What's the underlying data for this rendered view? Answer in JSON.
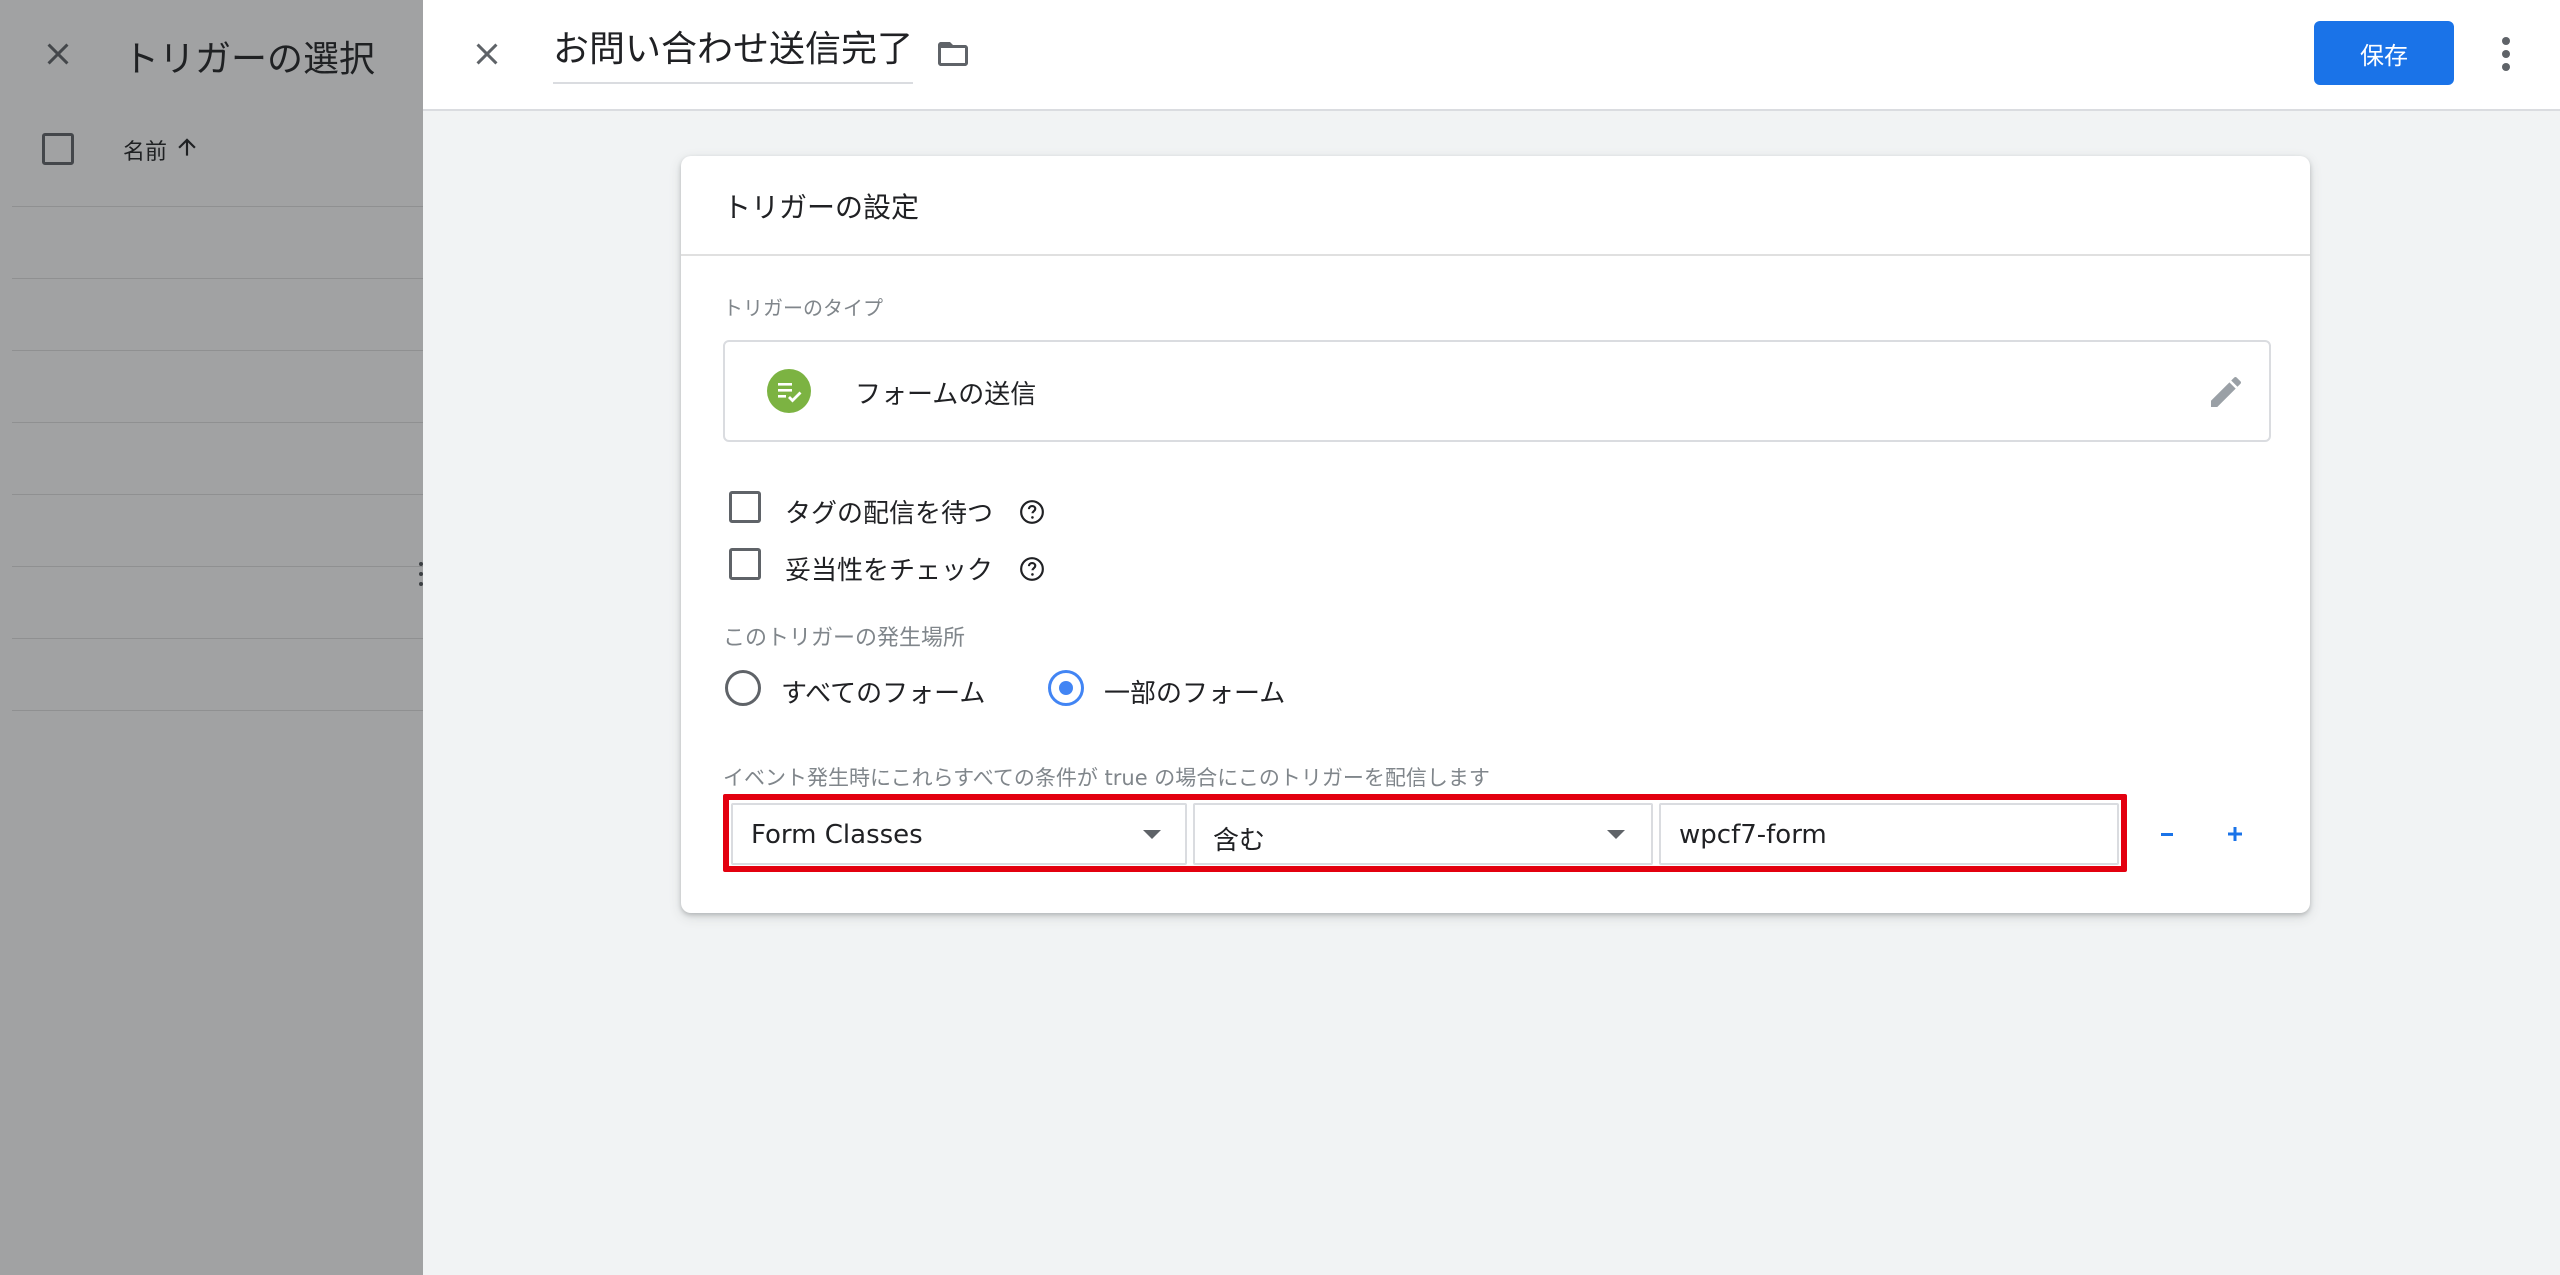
{
  "background_panel": {
    "title": "トリガーの選択",
    "column_name": "名前",
    "icons": {
      "close": "close-icon",
      "sort": "arrow-up-icon"
    }
  },
  "editor": {
    "trigger_name": "お問い合わせ送信完了",
    "save_label": "保存",
    "icons": {
      "close": "close-icon",
      "folder": "folder-icon",
      "more": "more-vert-icon"
    }
  },
  "card": {
    "title": "トリガーの設定",
    "type_label": "トリガーのタイプ",
    "type_name": "フォームの送信",
    "type_icon": "form-submit-icon",
    "checkboxes": [
      {
        "label": "タグの配信を待つ",
        "checked": false
      },
      {
        "label": "妥当性をチェック",
        "checked": false
      }
    ],
    "where_label": "このトリガーの発生場所",
    "radios": [
      {
        "label": "すべてのフォーム",
        "selected": false
      },
      {
        "label": "一部のフォーム",
        "selected": true
      }
    ],
    "condition_label": "イベント発生時にこれらすべての条件が true の場合にこのトリガーを配信します",
    "condition": {
      "variable": "Form Classes",
      "operator": "含む",
      "value": "wpcf7-form"
    },
    "remove_label": "-",
    "add_label": "+"
  },
  "colors": {
    "accent": "#1a73e8",
    "radio_selected": "#4285f4",
    "highlight_box": "#e3000f",
    "trigger_icon": "#7cb342"
  }
}
